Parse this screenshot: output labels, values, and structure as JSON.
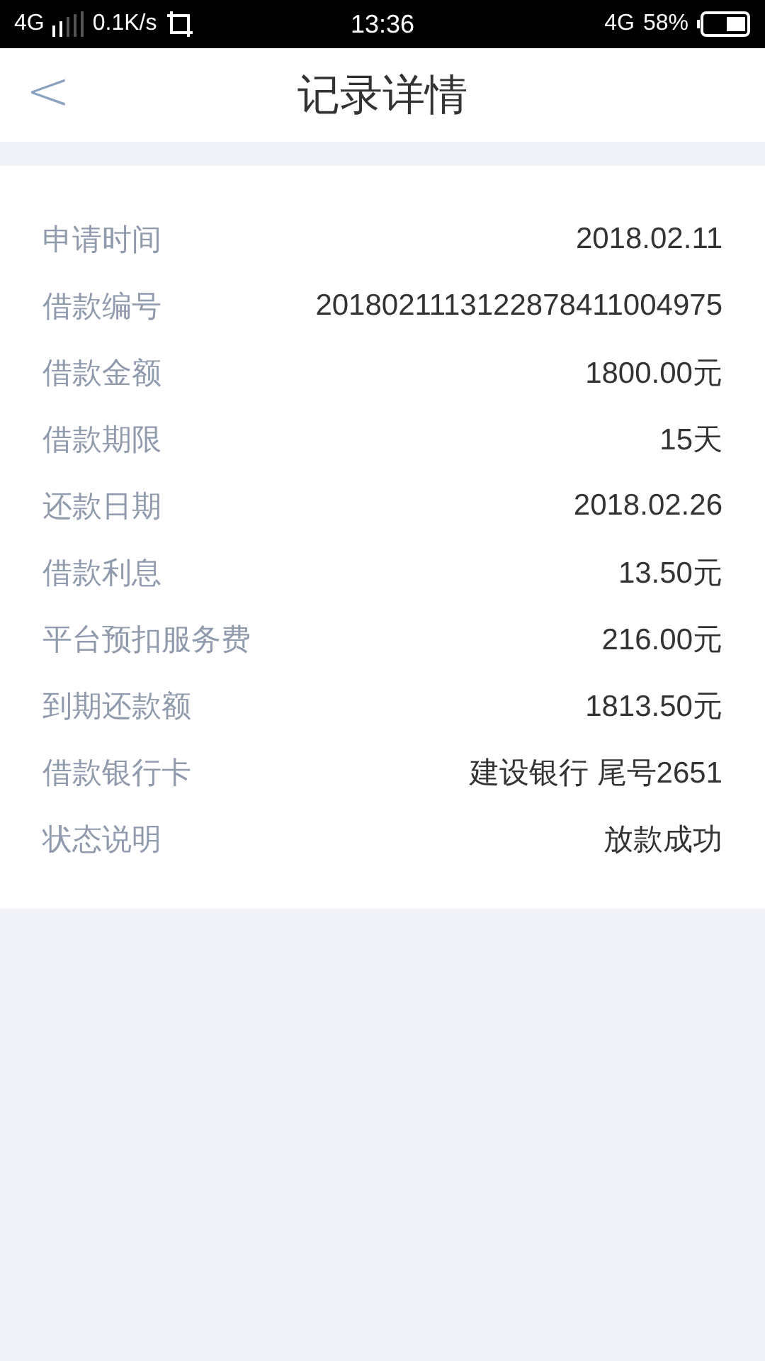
{
  "status_bar": {
    "network_left": "4G",
    "speed": "0.1K/s",
    "time": "13:36",
    "network_right": "4G",
    "battery": "58%"
  },
  "header": {
    "back": "<",
    "title": "记录详情"
  },
  "details": [
    {
      "label": "申请时间",
      "value": "2018.02.11"
    },
    {
      "label": "借款编号",
      "value": "2018021113122878411004975"
    },
    {
      "label": "借款金额",
      "value": "1800.00元"
    },
    {
      "label": "借款期限",
      "value": "15天"
    },
    {
      "label": "还款日期",
      "value": "2018.02.26"
    },
    {
      "label": "借款利息",
      "value": "13.50元"
    },
    {
      "label": "平台预扣服务费",
      "value": "216.00元"
    },
    {
      "label": "到期还款额",
      "value": "1813.50元"
    },
    {
      "label": "借款银行卡",
      "value": "建设银行 尾号2651"
    },
    {
      "label": "状态说明",
      "value": "放款成功"
    }
  ]
}
